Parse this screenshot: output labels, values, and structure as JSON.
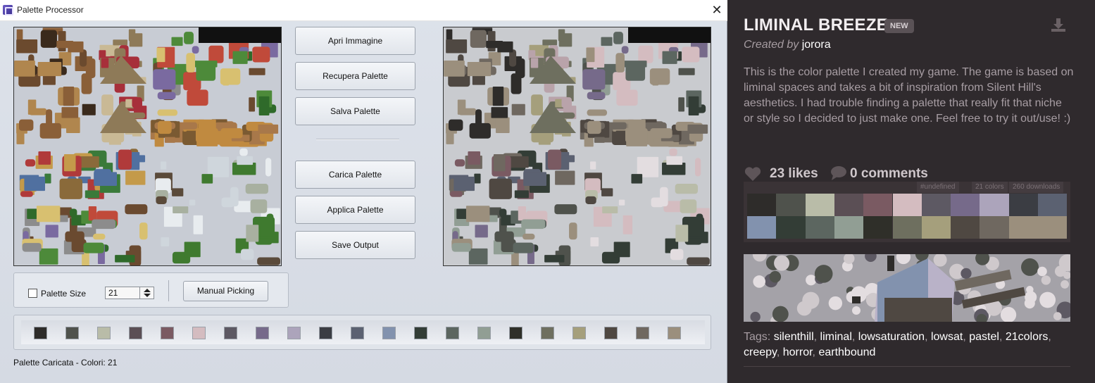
{
  "window": {
    "title": "Palette Processor",
    "close_glyph": "✕"
  },
  "buttons": {
    "open_image": "Apri Immagine",
    "recover_palette": "Recupera Palette",
    "save_palette": "Salva Palette",
    "load_palette": "Carica Palette",
    "apply_palette": "Applica Palette",
    "save_output": "Save Output",
    "manual_picking": "Manual Picking"
  },
  "options": {
    "palette_size_label": "Palette Size",
    "palette_size_value": "21",
    "palette_size_checked": false
  },
  "palette_strip": [
    "#2e2c2a",
    "#4f524c",
    "#b9bca8",
    "#5b4f55",
    "#7a5a62",
    "#d4bcc0",
    "#5d5963",
    "#766a8a",
    "#aca4bb",
    "#3b3d43",
    "#5b6171",
    "#8292ae",
    "#333d36",
    "#5c6660",
    "#919e94",
    "#2f2f29",
    "#6e6f5f",
    "#a59f7c",
    "#4f4842",
    "#6f6860",
    "#9b8f7d"
  ],
  "status": "Palette Caricata - Colori: 21",
  "palette_page": {
    "title": "LIMINAL BREEZE",
    "badge": "NEW",
    "created_by_label": "Created by",
    "author": "jorora",
    "description": "This is the color palette I created my game. The game is based on liminal spaces and takes a bit of inspiration from Silent Hill's aesthetics. I had trouble finding a palette that really fit that niche or style so I decided to just make one. Feel free to try it out/use! :)",
    "likes": "23 likes",
    "comments": "0 comments",
    "meta": {
      "hex": "#undefined",
      "colors": "21 colors",
      "downloads": "260 downloads"
    },
    "tags_label": "Tags:",
    "tags": [
      "silenthill",
      "liminal",
      "lowsaturation",
      "lowsat",
      "pastel",
      "21colors",
      "creepy",
      "horror",
      "earthbound"
    ]
  }
}
